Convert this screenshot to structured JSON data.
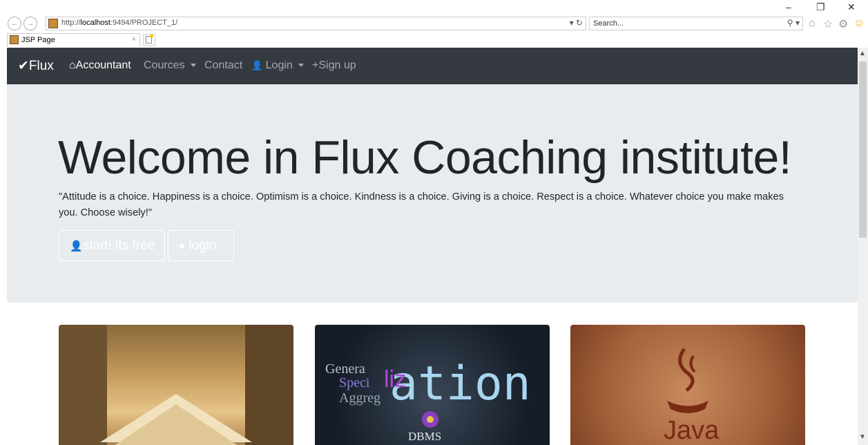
{
  "browser": {
    "url_prefix": "http://",
    "url_host": "localhost",
    "url_rest": ":9494/PROJECT_1/",
    "search_placeholder": "Search...",
    "tab_title": "JSP Page",
    "tab_close": "×",
    "addr_controls": "▾ ↻",
    "search_controls": "⚲ ▾",
    "minimize": "–",
    "restore": "❐",
    "close": "✕",
    "back": "←",
    "forward": "→",
    "home_icon": "⌂",
    "favorites_icon": "☆",
    "settings_icon": "⚙",
    "smiley_icon": "☺"
  },
  "navbar": {
    "brand": "Flux",
    "brand_icon": "✔",
    "home_icon": "⌂",
    "home": "Accountant",
    "cources": "Cources",
    "contact": "Contact",
    "login_icon": "👤",
    "login": "Login",
    "signup_icon": "+",
    "signup": "Sign up",
    "bg_color": "#343a40"
  },
  "jumbotron": {
    "headline": "Welcome in Flux Coaching institute!",
    "quote": "\"Attitude is a choice. Happiness is a choice. Optimism is a choice. Kindness is a choice. Giving is a choice. Respect is a choice. Whatever choice you make makes you. Choose wisely!\"",
    "start_label": "start! its free",
    "login_label": "login",
    "bg_color": "#e9ecef"
  },
  "cards": [
    {
      "name": "books",
      "text": ""
    },
    {
      "name": "dbms",
      "text": "DBMS"
    },
    {
      "name": "java",
      "text": "Java"
    }
  ]
}
